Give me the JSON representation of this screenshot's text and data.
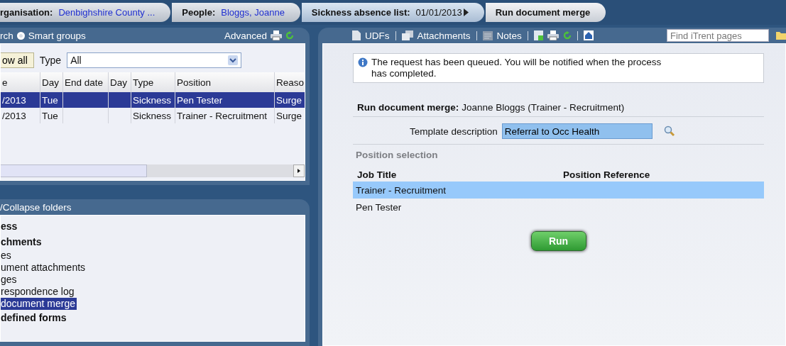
{
  "breadcrumbs": [
    {
      "label": "rganisation:",
      "value": "Denbighshire County ...",
      "selected": false,
      "arrow": false
    },
    {
      "label": "People:",
      "value": "Bloggs, Joanne",
      "selected": false,
      "arrow": false
    },
    {
      "label": "Sickness absence list:",
      "value": "01/01/2013",
      "selected": false,
      "arrow": true
    },
    {
      "label": "Run document merge",
      "selected": true,
      "arrow": false
    }
  ],
  "left_panel": {
    "search_label": "rch",
    "smart_groups": {
      "label": "Smart groups",
      "selected": true
    },
    "advanced": "Advanced",
    "show_all": "ow all",
    "type_label": "Type",
    "type_value": "All",
    "table": {
      "columns": [
        "e",
        "Day",
        "End date",
        "Day",
        "Type",
        "Position",
        "Reaso"
      ],
      "rows": [
        {
          "selected": true,
          "cells": [
            "/2013",
            "Tue",
            "",
            "",
            "Sickness",
            "Pen Tester",
            "Surge"
          ]
        },
        {
          "selected": false,
          "cells": [
            "/2013",
            "Tue",
            "",
            "",
            "Sickness",
            "Trainer - Recruitment",
            "Surge"
          ]
        }
      ]
    }
  },
  "folders_panel": {
    "title": "/Collapse folders",
    "tree": [
      {
        "label": "ess",
        "selected": false
      },
      {
        "label": "chments",
        "selected": false,
        "children": [
          {
            "label": "es",
            "selected": false
          },
          {
            "label": "ument attachments",
            "selected": false
          },
          {
            "label": "ges",
            "selected": false
          },
          {
            "label": "respondence log",
            "selected": false
          },
          {
            "label": "document merge",
            "selected": true
          }
        ]
      },
      {
        "label": "defined forms",
        "selected": false
      }
    ]
  },
  "toolbar": {
    "items": [
      "UDFs",
      "Attachments",
      "Notes"
    ],
    "search": {
      "placeholder": "Find iTrent pages"
    }
  },
  "main": {
    "message": "The request has been queued. You will be notified when the process has completed.",
    "heading_label": "Run document merge:",
    "heading_value": "Joanne Bloggs (Trainer - Recruitment)",
    "template_label": "Template description",
    "template_value": "Referral to Occ Health",
    "section": "Position selection",
    "columns": [
      "Job Title",
      "Position Reference"
    ],
    "positions": [
      {
        "job_title": "Trainer - Recruitment",
        "selected": true
      },
      {
        "job_title": "Pen Tester",
        "selected": false
      }
    ],
    "run_button": "Run"
  }
}
